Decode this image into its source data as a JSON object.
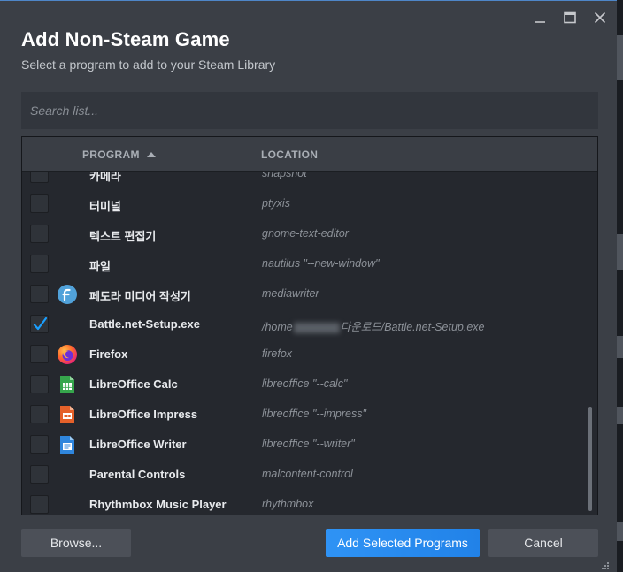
{
  "dialog": {
    "title": "Add Non-Steam Game",
    "subtitle": "Select a program to add to your Steam Library"
  },
  "window_controls": [
    "minimize-icon",
    "maximize-icon",
    "close-icon"
  ],
  "search": {
    "placeholder": "Search list...",
    "value": ""
  },
  "columns": {
    "program": "PROGRAM",
    "location": "LOCATION",
    "sort": "ascending"
  },
  "rows": [
    {
      "name": "카메라",
      "location": "snapshot",
      "checked": false,
      "icon": "none"
    },
    {
      "name": "터미널",
      "location": "ptyxis",
      "checked": false,
      "icon": "none"
    },
    {
      "name": "텍스트 편집기",
      "location": "gnome-text-editor",
      "checked": false,
      "icon": "none"
    },
    {
      "name": "파일",
      "location": "nautilus \"--new-window\"",
      "checked": false,
      "icon": "none"
    },
    {
      "name": "페도라 미디어 작성기",
      "location": "mediawriter",
      "checked": false,
      "icon": "fedora-icon"
    },
    {
      "name": "Battle.net-Setup.exe",
      "location_prefix": "/home",
      "location_suffix": "다운로드/Battle.net-Setup.exe",
      "checked": true,
      "icon": "none"
    },
    {
      "name": "Firefox",
      "location": "firefox",
      "checked": false,
      "icon": "firefox-icon"
    },
    {
      "name": "LibreOffice Calc",
      "location": "libreoffice \"--calc\"",
      "checked": false,
      "icon": "calc-icon"
    },
    {
      "name": "LibreOffice Impress",
      "location": "libreoffice \"--impress\"",
      "checked": false,
      "icon": "impress-icon"
    },
    {
      "name": "LibreOffice Writer",
      "location": "libreoffice \"--writer\"",
      "checked": false,
      "icon": "writer-icon"
    },
    {
      "name": "Parental Controls",
      "location": "malcontent-control",
      "checked": false,
      "icon": "none"
    },
    {
      "name": "Rhythmbox Music Player",
      "location": "rhythmbox",
      "checked": false,
      "icon": "none"
    }
  ],
  "buttons": {
    "browse": "Browse...",
    "add": "Add Selected Programs",
    "cancel": "Cancel"
  },
  "colors": {
    "accent": "#2a8ff0",
    "dialog_bg": "#3b3f46",
    "list_bg": "#25282e"
  }
}
